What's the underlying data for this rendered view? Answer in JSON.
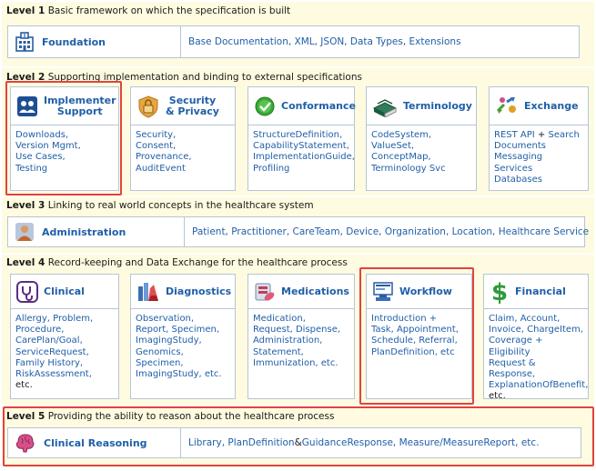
{
  "level1": {
    "num": "Level 1",
    "desc": "Basic framework on which the specification is built",
    "name": "Foundation",
    "links": "Base Documentation, XML, JSON, Data Types, Extensions"
  },
  "level2": {
    "num": "Level 2",
    "desc": "Supporting implementation and binding to external specifications",
    "boxes": [
      {
        "name1": "Implementer",
        "name2": "Support",
        "lines": [
          "Downloads,",
          "Version Mgmt,",
          "Use Cases,",
          "Testing"
        ]
      },
      {
        "name1": "Security",
        "name2": "& Privacy",
        "lines": [
          "Security,",
          "Consent,",
          "Provenance,",
          "AuditEvent"
        ]
      },
      {
        "name1": "Conformance",
        "lines": [
          "StructureDefinition,",
          "CapabilityStatement,",
          "ImplementationGuide,",
          "Profiling"
        ]
      },
      {
        "name1": "Terminology",
        "lines": [
          "CodeSystem,",
          "ValueSet,",
          "ConceptMap,",
          "Terminology Svc"
        ]
      },
      {
        "name1": "Exchange",
        "l1a": "REST API",
        "l1b": " + ",
        "l1c": "Search",
        "lines": [
          "Documents",
          "Messaging",
          "Services",
          "Databases"
        ]
      }
    ]
  },
  "level3": {
    "num": "Level 3",
    "desc": "Linking to real world concepts in the healthcare system",
    "name": "Administration",
    "links": "Patient, Practitioner, CareTeam, Device, Organization, Location, Healthcare Service"
  },
  "level4": {
    "num": "Level 4",
    "desc": "Record-keeping and Data Exchange for the healthcare process",
    "boxes": [
      {
        "name": "Clinical",
        "lines": [
          "Allergy, Problem,",
          "Procedure,",
          "CarePlan/Goal,",
          "ServiceRequest,",
          "Family History,",
          "RiskAssessment,",
          "etc."
        ]
      },
      {
        "name": "Diagnostics",
        "lines": [
          "Observation,",
          "Report, Specimen,",
          "ImagingStudy,",
          "Genomics,",
          "Specimen,",
          "ImagingStudy, etc."
        ]
      },
      {
        "name": "Medications",
        "lines": [
          "Medication,",
          "Request, Dispense,",
          "Administration,",
          "Statement,",
          "Immunization, etc."
        ]
      },
      {
        "name": "Workflow",
        "lines": [
          "Introduction +",
          "Task, Appointment,",
          "Schedule, Referral,",
          "PlanDefinition, etc"
        ]
      },
      {
        "name": "Financial",
        "lines": [
          "Claim, Account,",
          "Invoice, ChargeItem,",
          "Coverage + Eligibility",
          "Request & Response,",
          "ExplanationOfBenefit,",
          "etc."
        ]
      }
    ]
  },
  "level5": {
    "num": "Level 5",
    "desc": "Providing the ability to reason about the healthcare process",
    "name": "Clinical Reasoning",
    "l1": "Library, PlanDefinition",
    "l2": " & ",
    "l3": "GuidanceResponse, Measure/MeasureReport, etc."
  }
}
